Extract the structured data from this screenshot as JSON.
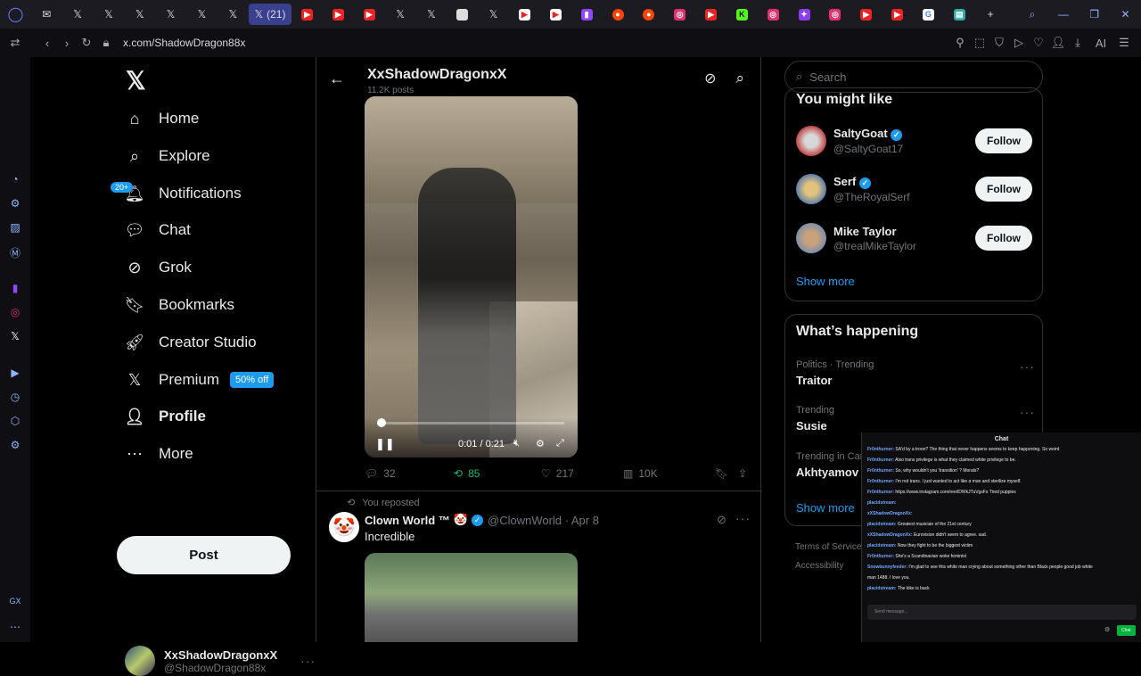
{
  "browser": {
    "tab_label": "(21)",
    "url": "x.com/ShadowDragon88x"
  },
  "nav": {
    "items": [
      "Home",
      "Explore",
      "Notifications",
      "Chat",
      "Grok",
      "Bookmarks",
      "Creator Studio",
      "Premium",
      "Profile",
      "More"
    ],
    "notif_badge": "20+",
    "premium_badge": "50% off",
    "post": "Post"
  },
  "account": {
    "name": "XxShadowDragonxX",
    "handle": "@ShadowDragon88x"
  },
  "header": {
    "name": "XxShadowDragonxX",
    "posts": "11.2K posts"
  },
  "video": {
    "time": "0:01 / 0:21"
  },
  "tweet1": {
    "replies": "32",
    "reposts": "85",
    "likes": "217",
    "views": "10K"
  },
  "tweet2": {
    "reposted": "You reposted",
    "name": "Clown World ™",
    "handle": "@ClownWorld · Apr 8",
    "text": "Incredible"
  },
  "right": {
    "search_placeholder": "Search",
    "ymlTitle": "You might like",
    "suggestions": [
      {
        "name": "SaltyGoat",
        "handle": "@SaltyGoat17",
        "btn": "Follow"
      },
      {
        "name": "Serf",
        "handle": "@TheRoyalSerf",
        "btn": "Follow"
      },
      {
        "name": "Mike Taylor",
        "handle": "@trealMikeTaylor",
        "btn": "Follow"
      }
    ],
    "show_more": "Show more",
    "happening": "What’s happening",
    "trends": [
      {
        "ctx": "Politics · Trending",
        "name": "Traitor"
      },
      {
        "ctx": "Trending",
        "name": "Susie"
      },
      {
        "ctx": "Trending in Car",
        "name": "Akhtyamov"
      }
    ],
    "show_more2": "Show more",
    "footer1": "Terms of Service",
    "footer2": "Accessibility"
  },
  "chat": {
    "title": "Chat",
    "placeholder": "Send message...",
    "send": "Chat",
    "lines": [
      {
        "user": "Fr0nthurner:",
        "msg": "SA'd by a troon? The thing that never happens seems to keep happening. So weird"
      },
      {
        "user": "Fr0nthurner:",
        "msg": "Also trans privilege is what they claimed white privilege to be."
      },
      {
        "user": "Fr0nthurner:",
        "msg": "So, why wouldn't you 'transition' ? Morals?"
      },
      {
        "user": "Fr0nthurner:",
        "msg": "I'm not trans. I just wanted to act like a man and sterilize myself."
      },
      {
        "user": "Fr0nthurner:",
        "msg": "https://www.instagram.com/reel/DWkJTuVgsFs Tired puppies"
      },
      {
        "user": "placidstream:",
        "msg": ""
      },
      {
        "user": "xXShadowDragonXx:",
        "msg": ""
      },
      {
        "user": "placidstream:",
        "msg": "Greatest musician of the 21st century"
      },
      {
        "user": "xXShadowDragonXx:",
        "msg": "Eurovision didn't seem to agree. sad."
      },
      {
        "user": "placidstream:",
        "msg": "Now they fight to be the biggest victim"
      },
      {
        "user": "Fr0nthurner:",
        "msg": "She's a Scandinavian woke feminist"
      },
      {
        "user": "Snowbunnyfeeder:",
        "msg": "I'm glad to see this white man crying about something other than Black people good job white"
      },
      {
        "user": "",
        "msg": "man 1488. I love you."
      },
      {
        "user": "placidstream:",
        "msg": "The kike is back"
      }
    ]
  }
}
